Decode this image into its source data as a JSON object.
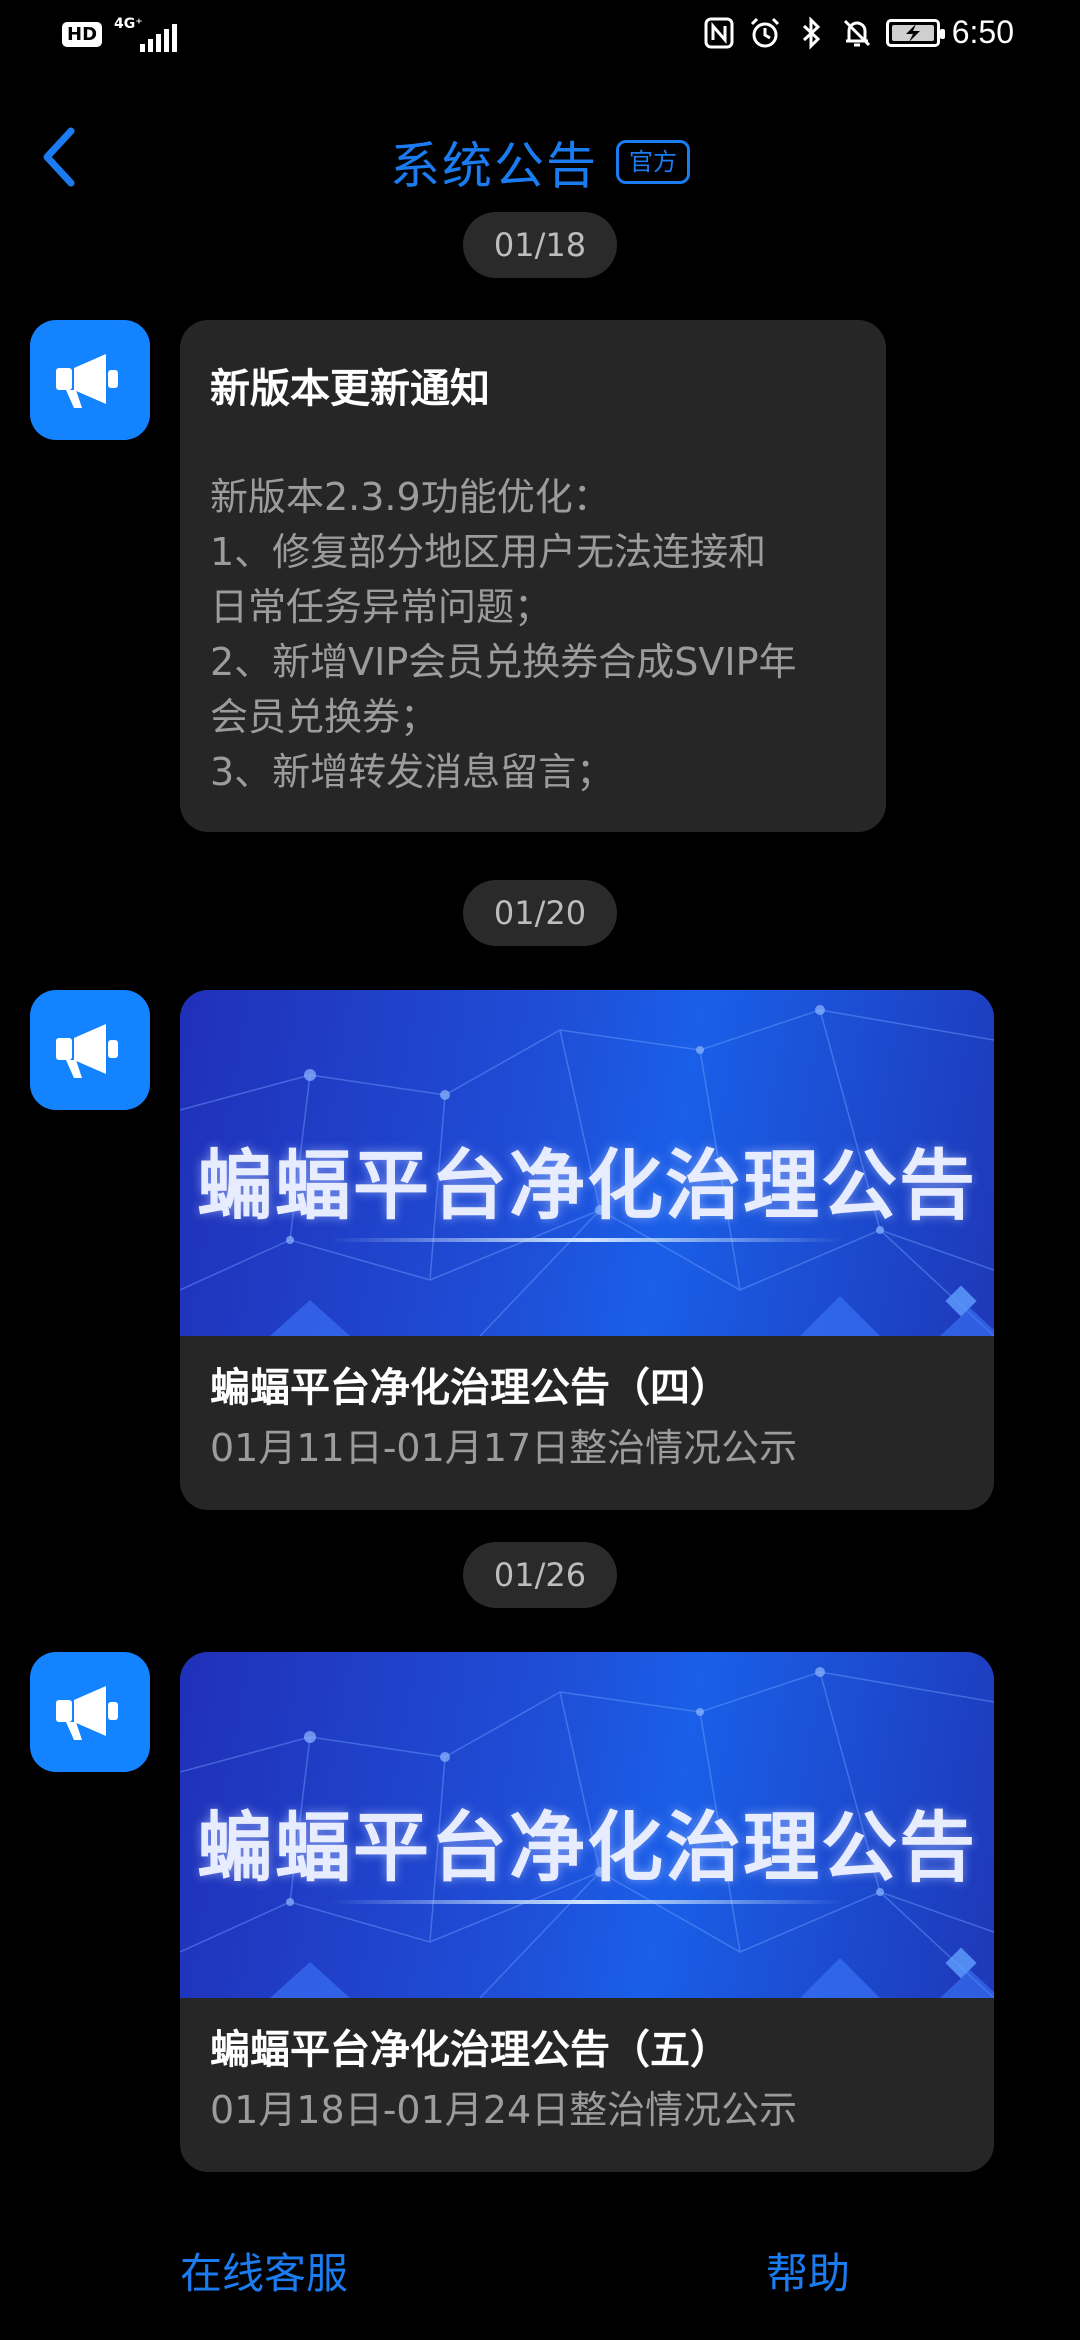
{
  "status_bar": {
    "left_badge": "HD",
    "network": "4G⁺",
    "time": "6:50",
    "icons": [
      "nfc-icon",
      "alarm-icon",
      "bluetooth-icon",
      "mute-icon",
      "battery-charging-icon"
    ]
  },
  "header": {
    "back_icon": "chevron-left-icon",
    "title": "系统公告",
    "badge": "官方"
  },
  "messages": [
    {
      "date": "01/18",
      "type": "text",
      "title": "新版本更新通知",
      "lines": [
        "新版本2.3.9功能优化：",
        "1、修复部分地区用户无法连接和",
        "日常任务异常问题；",
        "2、新增VIP会员兑换券合成SVIP年",
        "会员兑换券；",
        "3、新增转发消息留言；"
      ]
    },
    {
      "date": "01/20",
      "type": "image",
      "banner_text": "蝙蝠平台净化治理公告",
      "title": "蝙蝠平台净化治理公告（四）",
      "subtitle": "01月11日-01月17日整治情况公示"
    },
    {
      "date": "01/26",
      "type": "image",
      "banner_text": "蝙蝠平台净化治理公告",
      "title": "蝙蝠平台净化治理公告（五）",
      "subtitle": "01月18日-01月24日整治情况公示"
    }
  ],
  "bottom": {
    "left": "在线客服",
    "right": "帮助"
  },
  "colors": {
    "accent": "#1a7cf0",
    "avatar": "#1483ff",
    "card": "#262626",
    "pill": "#2a2a2a"
  }
}
